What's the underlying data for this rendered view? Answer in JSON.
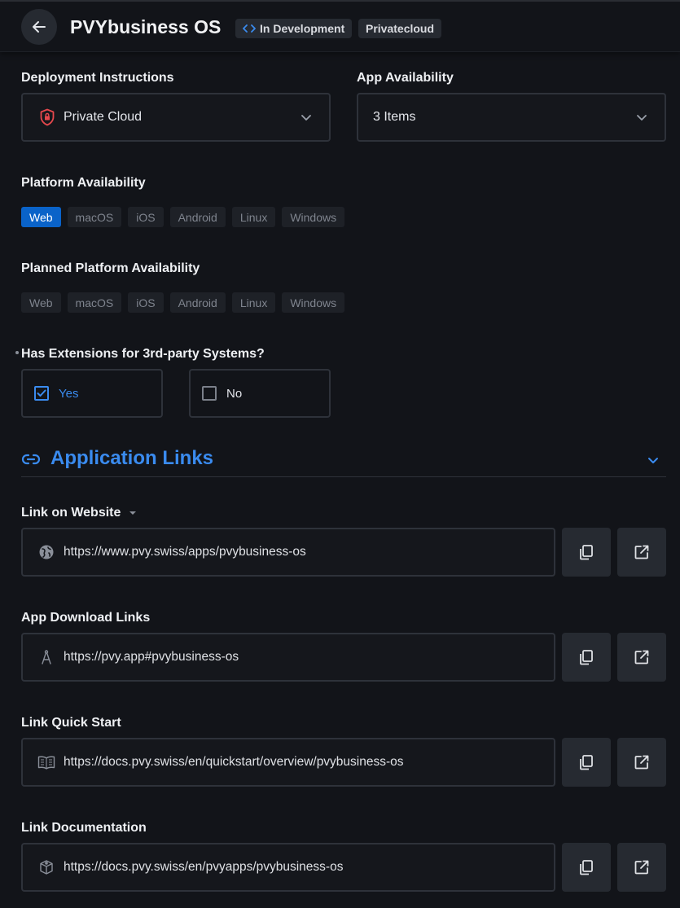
{
  "header": {
    "title": "PVYbusiness OS",
    "status_badge": "In Development",
    "cloud_badge": "Privatecloud"
  },
  "deployment": {
    "label": "Deployment Instructions",
    "value": "Private Cloud"
  },
  "availability": {
    "label": "App Availability",
    "value": "3 Items"
  },
  "platform": {
    "label": "Platform Availability",
    "chips": [
      "Web",
      "macOS",
      "iOS",
      "Android",
      "Linux",
      "Windows"
    ],
    "active": "Web"
  },
  "planned_platform": {
    "label": "Planned Platform Availability",
    "chips": [
      "Web",
      "macOS",
      "iOS",
      "Android",
      "Linux",
      "Windows"
    ]
  },
  "extensions": {
    "label": "Has Extensions for 3rd-party Systems?",
    "yes": "Yes",
    "no": "No",
    "selected": "Yes"
  },
  "links_section": {
    "title": "Application Links"
  },
  "links": [
    {
      "label": "Link on Website",
      "url": "https://www.pvy.swiss/apps/pvybusiness-os",
      "icon": "globe-icon"
    },
    {
      "label": "App Download Links",
      "url": "https://pvy.app#pvybusiness-os",
      "icon": "compass-icon"
    },
    {
      "label": "Link Quick Start",
      "url": "https://docs.pvy.swiss/en/quickstart/overview/pvybusiness-os",
      "icon": "book-icon"
    },
    {
      "label": "Link Documentation",
      "url": "https://docs.pvy.swiss/en/pvyapps/pvybusiness-os",
      "icon": "package-icon"
    }
  ],
  "colors": {
    "accent": "#3a8bef",
    "chip_active": "#0a63c9",
    "shield": "#e5484d"
  }
}
